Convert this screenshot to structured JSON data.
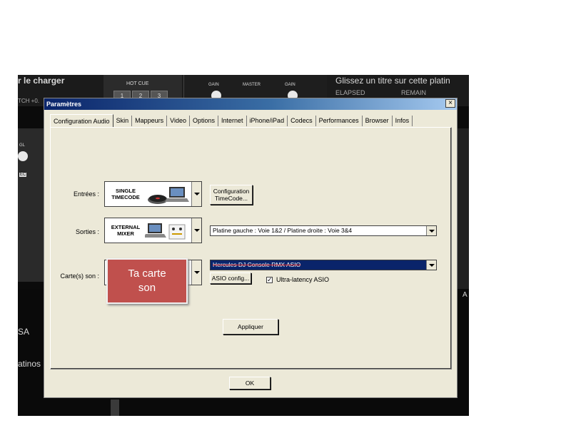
{
  "background_app": {
    "left_title": "r le charger",
    "hot_cue_label": "HOT CUE",
    "hot_cue_buttons": [
      "1",
      "2",
      "3"
    ],
    "gain_left": "GAIN",
    "master": "MASTER",
    "gain_right": "GAIN",
    "right_title": "Glissez un titre sur cette platin",
    "elapsed": "ELAPSED",
    "remain": "REMAIN",
    "pitch_label": "TCH +0.",
    "left_small_1": "GL",
    "left_small_2": "EC",
    "left_text_1": "SA",
    "left_text_2": "atinos",
    "right_text": "A"
  },
  "dialog": {
    "title": "Paramètres",
    "close": "×",
    "tabs": [
      {
        "label": "Configuration Audio",
        "active": true
      },
      {
        "label": "Skin"
      },
      {
        "label": "Mappeurs"
      },
      {
        "label": "Video"
      },
      {
        "label": "Options"
      },
      {
        "label": "Internet"
      },
      {
        "label": "iPhone/iPad"
      },
      {
        "label": "Codecs"
      },
      {
        "label": "Performances"
      },
      {
        "label": "Browser"
      },
      {
        "label": "Infos"
      }
    ],
    "inputs_label": "Entrées :",
    "inputs_device_line1": "SINGLE",
    "inputs_device_line2": "TIMECODE",
    "timecode_button": "Configuration TimeCode...",
    "outputs_label": "Sorties :",
    "outputs_device_line1": "EXTERNAL",
    "outputs_device_line2": "MIXER",
    "outputs_selected": "Platine gauche : Voie 1&2 / Platine droite : Voie 3&4",
    "soundcard_label": "Carte(s) son :",
    "soundcard_selected": "Hercules DJ Console RMX ASIO",
    "asio_button": "ASIO config...",
    "ultra_latency_label": "Ultra-latency ASIO",
    "ultra_latency_checked": "✓",
    "apply_button": "Appliquer",
    "ok_button": "OK"
  },
  "annotation": {
    "callout_line1": "Ta carte",
    "callout_line2": "son",
    "color": "#c0504d"
  },
  "colors": {
    "titlebar_start": "#0a246a",
    "titlebar_end": "#a6caf0",
    "dialog_bg": "#ece9d8",
    "selection_bg": "#0a246a"
  }
}
